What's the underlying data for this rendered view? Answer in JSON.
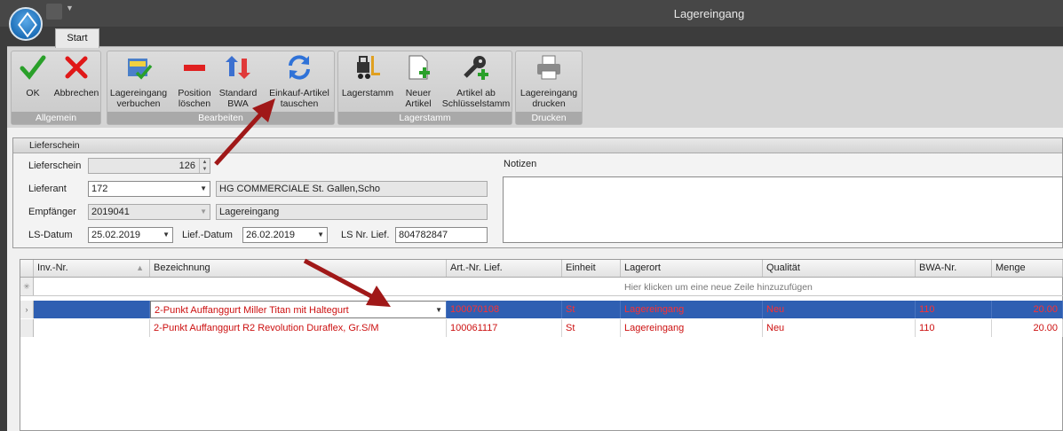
{
  "window": {
    "title": "Lagereingang"
  },
  "ribbon": {
    "tab": "Start",
    "groups": [
      {
        "label": "Allgemein",
        "buttons": [
          "OK",
          "Abbrechen"
        ]
      },
      {
        "label": "Bearbeiten",
        "buttons": [
          "Lagereingang verbuchen",
          "Position löschen",
          "Standard BWA",
          "Einkauf-Artikel tauschen"
        ]
      },
      {
        "label": "Lagerstamm",
        "buttons": [
          "Lagerstamm",
          "Neuer Artikel",
          "Artikel ab Schlüsselstamm"
        ]
      },
      {
        "label": "Drucken",
        "buttons": [
          "Lagereingang drucken"
        ]
      }
    ],
    "btn": {
      "ok": "OK",
      "abbrechen": "Abbrechen",
      "verbuchen_1": "Lagereingang",
      "verbuchen_2": "verbuchen",
      "loeschen_1": "Position",
      "loeschen_2": "löschen",
      "bwa_1": "Standard",
      "bwa_2": "BWA",
      "tauschen_1": "Einkauf-Artikel",
      "tauschen_2": "tauschen",
      "lagerstamm": "Lagerstamm",
      "neu_1": "Neuer",
      "neu_2": "Artikel",
      "schluessel_1": "Artikel ab",
      "schluessel_2": "Schlüsselstamm",
      "drucken_1": "Lagereingang",
      "drucken_2": "drucken"
    },
    "group_labels": {
      "allgemein": "Allgemein",
      "bearbeiten": "Bearbeiten",
      "lagerstamm": "Lagerstamm",
      "drucken": "Drucken"
    }
  },
  "lieferschein": {
    "header": "Lieferschein",
    "lieferschein_label": "Lieferschein",
    "lieferschein_value": "126",
    "lieferant_label": "Lieferant",
    "lieferant_value": "172",
    "lieferant_name": "HG COMMERCIALE St. Gallen,Scho",
    "empfaenger_label": "Empfänger",
    "empfaenger_value": "2019041",
    "empfaenger_name": "Lagereingang",
    "ls_datum_label": "LS-Datum",
    "ls_datum_value": "25.02.2019",
    "lief_datum_label": "Lief.-Datum",
    "lief_datum_value": "26.02.2019",
    "ls_nr_label": "LS Nr. Lief.",
    "ls_nr_value": "804782847",
    "notizen_label": "Notizen"
  },
  "grid": {
    "columns": [
      "Inv.-Nr.",
      "Bezeichnung",
      "Art.-Nr. Lief.",
      "Einheit",
      "Lagerort",
      "Qualität",
      "BWA-Nr.",
      "Menge"
    ],
    "new_row_hint": "Hier klicken um eine neue Zeile hinzuzufügen",
    "rows": [
      {
        "inv": "",
        "bezeichnung": "2-Punkt Auffanggurt Miller Titan mit Haltegurt",
        "artnr": "100070108",
        "einheit": "St",
        "lagerort": "Lagereingang",
        "qualitaet": "Neu",
        "bwa": "110",
        "menge": "20.00"
      },
      {
        "inv": "",
        "bezeichnung": "2-Punkt Auffanggurt R2 Revolution Duraflex, Gr.S/M",
        "artnr": "100061117",
        "einheit": "St",
        "lagerort": "Lagereingang",
        "qualitaet": "Neu",
        "bwa": "110",
        "menge": "20.00"
      }
    ]
  },
  "colors": {
    "selected_row": "#2f5fb2",
    "row_text": "#cc1010",
    "annotation_arrow": "#a01818"
  }
}
